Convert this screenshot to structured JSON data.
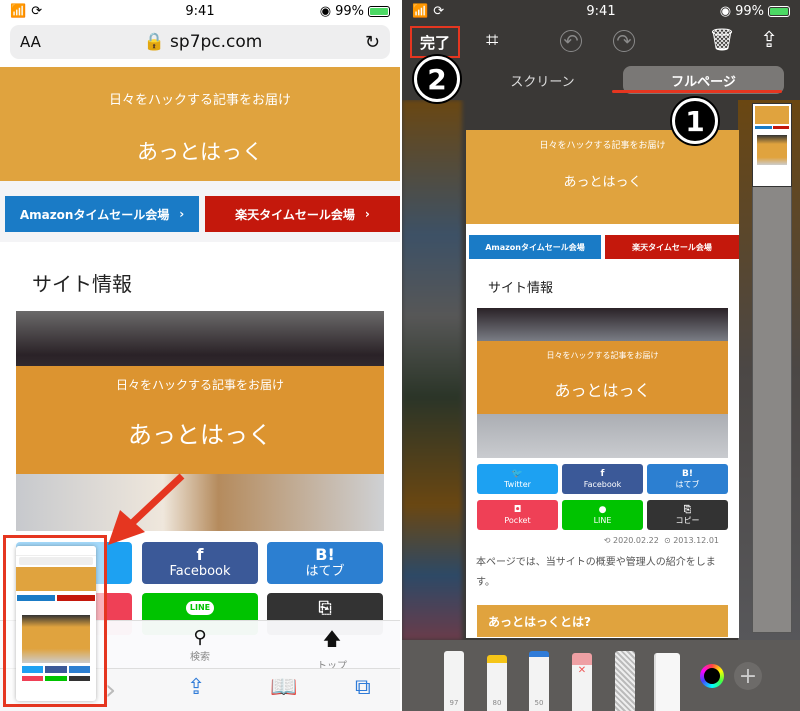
{
  "status": {
    "time": "9:41",
    "battery": "99%"
  },
  "left": {
    "browser": {
      "text_size_label": "AA",
      "url": "sp7pc.com"
    },
    "hero": {
      "tagline": "日々をハックする記事をお届け",
      "site_title": "あっとはっく"
    },
    "sale_buttons": [
      {
        "label": "Amazonタイムセール会場",
        "chevron": "›",
        "color": "#1a7bc6"
      },
      {
        "label": "楽天タイムセール会場",
        "chevron": "›",
        "color": "#c4180c"
      }
    ],
    "section_heading": "サイト情報",
    "photo": {
      "tagline": "日々をハックする記事をお届け",
      "title": "あっとはっく"
    },
    "share_buttons": [
      {
        "icon": "f",
        "label": "Facebook",
        "color": "#3b5998"
      },
      {
        "icon": "B!",
        "label": "はてブ",
        "color": "#2c7fd1"
      },
      {
        "icon": "LINE",
        "label": "",
        "color": "#00c300"
      },
      {
        "icon": "⎘",
        "label": "",
        "color": "#333333"
      }
    ],
    "bottom_nav": [
      {
        "icon": "search-icon",
        "glyph": "🔍",
        "label": "検索"
      },
      {
        "icon": "arrow-up-icon",
        "glyph": "🡅",
        "label": "トップ"
      }
    ],
    "toolbar": {
      "forward": "›",
      "share": "⇪",
      "bookmarks": "📖",
      "tabs": "⧉"
    }
  },
  "right": {
    "top": {
      "done_label": "完了",
      "crop": "⌗",
      "undo": "↶",
      "redo": "↷",
      "trash": "🗑",
      "share": "⇪"
    },
    "segments": [
      {
        "label": "スクリーン",
        "active": false
      },
      {
        "label": "フルページ",
        "active": true
      }
    ],
    "annotations": {
      "badge1": "1",
      "badge2": "2"
    },
    "doc": {
      "hero_tagline": "日々をハックする記事をお届け",
      "hero_title": "あっとはっく",
      "sale_buttons": [
        "Amazonタイムセール会場",
        "楽天タイムセール会場"
      ],
      "section_heading": "サイト情報",
      "photo_tagline": "日々をハックする記事をお届け",
      "photo_title": "あっとはっく",
      "share_buttons": [
        {
          "icon": "🐦",
          "label": "Twitter",
          "color": "#1da1f2"
        },
        {
          "icon": "f",
          "label": "Facebook",
          "color": "#3b5998"
        },
        {
          "icon": "B!",
          "label": "はてブ",
          "color": "#2c7fd1"
        },
        {
          "icon": "◘",
          "label": "Pocket",
          "color": "#ef4056"
        },
        {
          "icon": "●",
          "label": "LINE",
          "color": "#00c300"
        },
        {
          "icon": "⎘",
          "label": "コピー",
          "color": "#333333"
        }
      ],
      "updated_date": "2020.02.22",
      "published_date": "2013.12.01",
      "intro": "本ページでは、当サイトの概要や管理人の紹介をします。",
      "subheading": "あっとはっくとは?"
    },
    "tools": [
      {
        "name": "pen",
        "label": "97"
      },
      {
        "name": "marker",
        "label": "80"
      },
      {
        "name": "pencil",
        "label": "50"
      },
      {
        "name": "eraser",
        "label": ""
      },
      {
        "name": "lasso",
        "label": ""
      },
      {
        "name": "ruler",
        "label": ""
      }
    ],
    "add_label": "+"
  }
}
